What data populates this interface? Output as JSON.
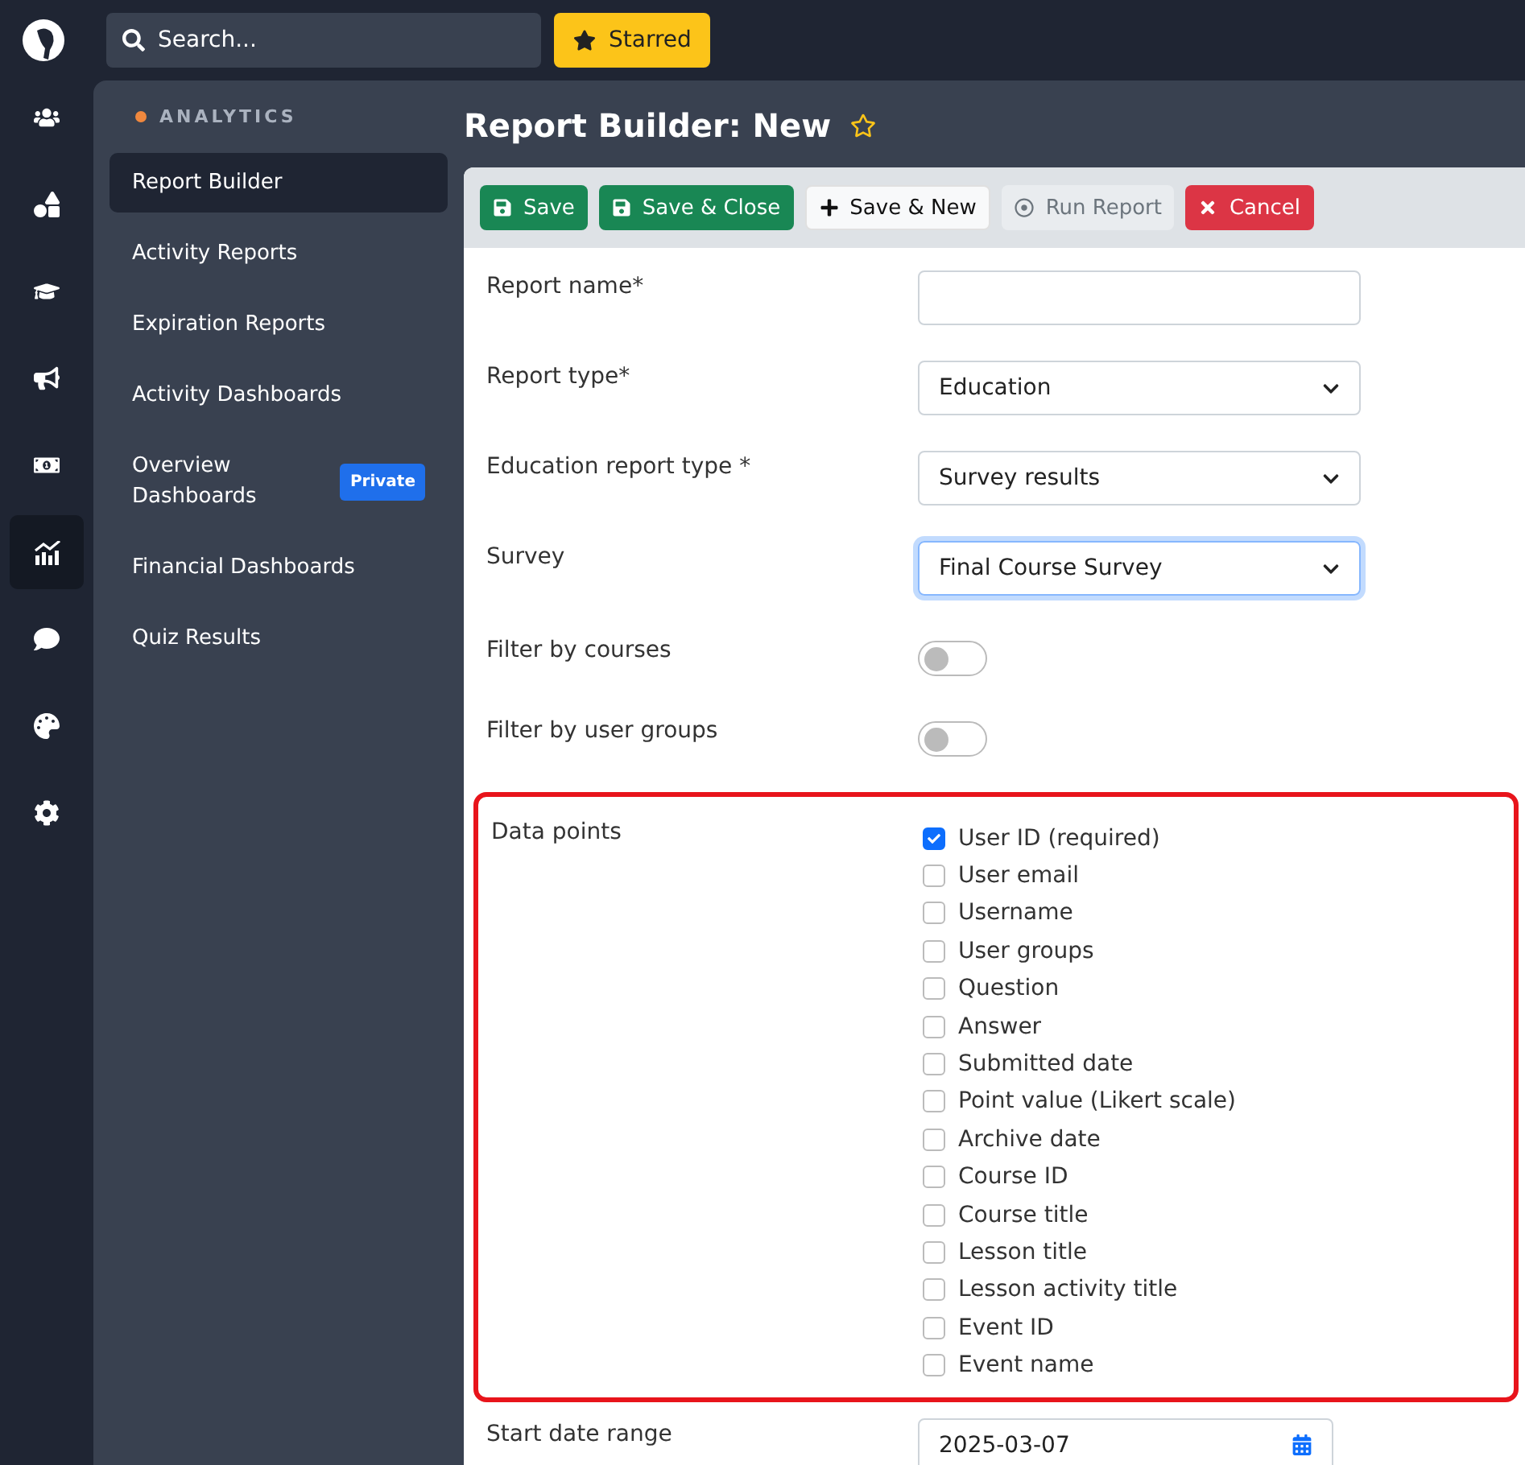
{
  "topbar": {
    "search": {
      "placeholder": "Search..."
    },
    "starred_button": "Starred"
  },
  "rail": [
    {
      "selected": false
    },
    {
      "selected": false
    },
    {
      "selected": false
    },
    {
      "selected": false
    },
    {
      "selected": false
    },
    {
      "selected": true
    },
    {
      "selected": false
    },
    {
      "selected": false
    },
    {
      "selected": false
    }
  ],
  "sidebar": {
    "section": "ANALYTICS",
    "items": [
      {
        "label": "Report Builder",
        "selected": true
      },
      {
        "label": "Activity Reports",
        "selected": false
      },
      {
        "label": "Expiration Reports",
        "selected": false
      },
      {
        "label": "Activity Dashboards",
        "selected": false
      },
      {
        "label": "Overview Dashboards",
        "selected": false,
        "badge": "Private"
      },
      {
        "label": "Financial Dashboards",
        "selected": false
      },
      {
        "label": "Quiz Results",
        "selected": false
      }
    ]
  },
  "page": {
    "title": "Report Builder: New",
    "starred": false
  },
  "toolbar": [
    {
      "label": "Save",
      "kind": "success"
    },
    {
      "label": "Save & Close",
      "kind": "success"
    },
    {
      "label": "Save & New",
      "kind": "light"
    },
    {
      "label": "Run Report",
      "kind": "disabled"
    },
    {
      "label": "Cancel",
      "kind": "danger"
    }
  ],
  "form": [
    {
      "kind": "text",
      "label": "Report name*"
    },
    {
      "kind": "select",
      "label": "Report type*",
      "value": "Education",
      "focused": false
    },
    {
      "kind": "select",
      "label": "Education report type *",
      "value": "Survey results",
      "focused": false
    },
    {
      "kind": "select",
      "label": "Survey",
      "value": "Final Course Survey",
      "focused": true
    },
    {
      "kind": "toggle",
      "label": "Filter by courses",
      "on": false
    },
    {
      "kind": "toggle",
      "label": "Filter by user groups",
      "on": false
    },
    {
      "kind": "checklist",
      "label": "Data points",
      "highlighted": true,
      "options": [
        {
          "label": "User ID (required)",
          "checked": true
        },
        {
          "label": "User email",
          "checked": false
        },
        {
          "label": "Username",
          "checked": false
        },
        {
          "label": "User groups",
          "checked": false
        },
        {
          "label": "Question",
          "checked": false
        },
        {
          "label": "Answer",
          "checked": false
        },
        {
          "label": "Submitted date",
          "checked": false
        },
        {
          "label": "Point value (Likert scale)",
          "checked": false
        },
        {
          "label": "Archive date",
          "checked": false
        },
        {
          "label": "Course ID",
          "checked": false
        },
        {
          "label": "Course title",
          "checked": false
        },
        {
          "label": "Lesson title",
          "checked": false
        },
        {
          "label": "Lesson activity title",
          "checked": false
        },
        {
          "label": "Event ID",
          "checked": false
        },
        {
          "label": "Event name",
          "checked": false
        }
      ]
    },
    {
      "kind": "date",
      "label": "Start date range",
      "value": "2025-03-07"
    }
  ]
}
